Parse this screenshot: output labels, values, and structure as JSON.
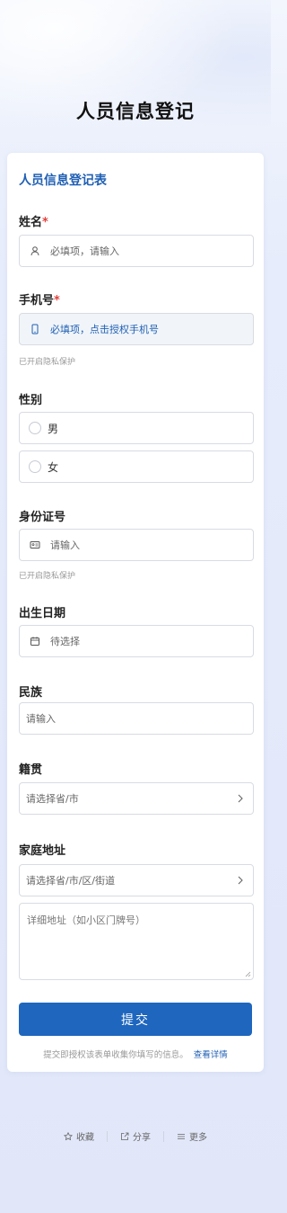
{
  "page": {
    "title": "人员信息登记"
  },
  "form": {
    "title": "人员信息登记表",
    "name": {
      "label": "姓名",
      "required_mark": "*",
      "placeholder": "必填项，请输入"
    },
    "phone": {
      "label": "手机号",
      "required_mark": "*",
      "placeholder": "必填项，点击授权手机号",
      "hint": "已开启隐私保护"
    },
    "gender": {
      "label": "性别",
      "options": [
        "男",
        "女"
      ]
    },
    "id_number": {
      "label": "身份证号",
      "placeholder": "请输入",
      "hint": "已开启隐私保护"
    },
    "birthdate": {
      "label": "出生日期",
      "placeholder": "待选择"
    },
    "ethnicity": {
      "label": "民族",
      "placeholder": "请输入"
    },
    "native_place": {
      "label": "籍贯",
      "placeholder": "请选择省/市"
    },
    "address": {
      "label": "家庭地址",
      "placeholder": "请选择省/市/区/街道",
      "detail_placeholder": "详细地址（如小区门牌号）"
    },
    "submit_label": "提交",
    "consent_text": "提交即授权该表单收集你填写的信息。",
    "consent_link": "查看详情"
  },
  "footer": {
    "favorite": "收藏",
    "share": "分享",
    "more": "更多"
  },
  "colors": {
    "accent": "#1e66be",
    "required": "#e0413c"
  },
  "icons": [
    "user-icon",
    "phone-icon",
    "id-card-icon",
    "calendar-icon",
    "chevron-right-icon",
    "star-icon",
    "share-icon",
    "menu-icon"
  ]
}
